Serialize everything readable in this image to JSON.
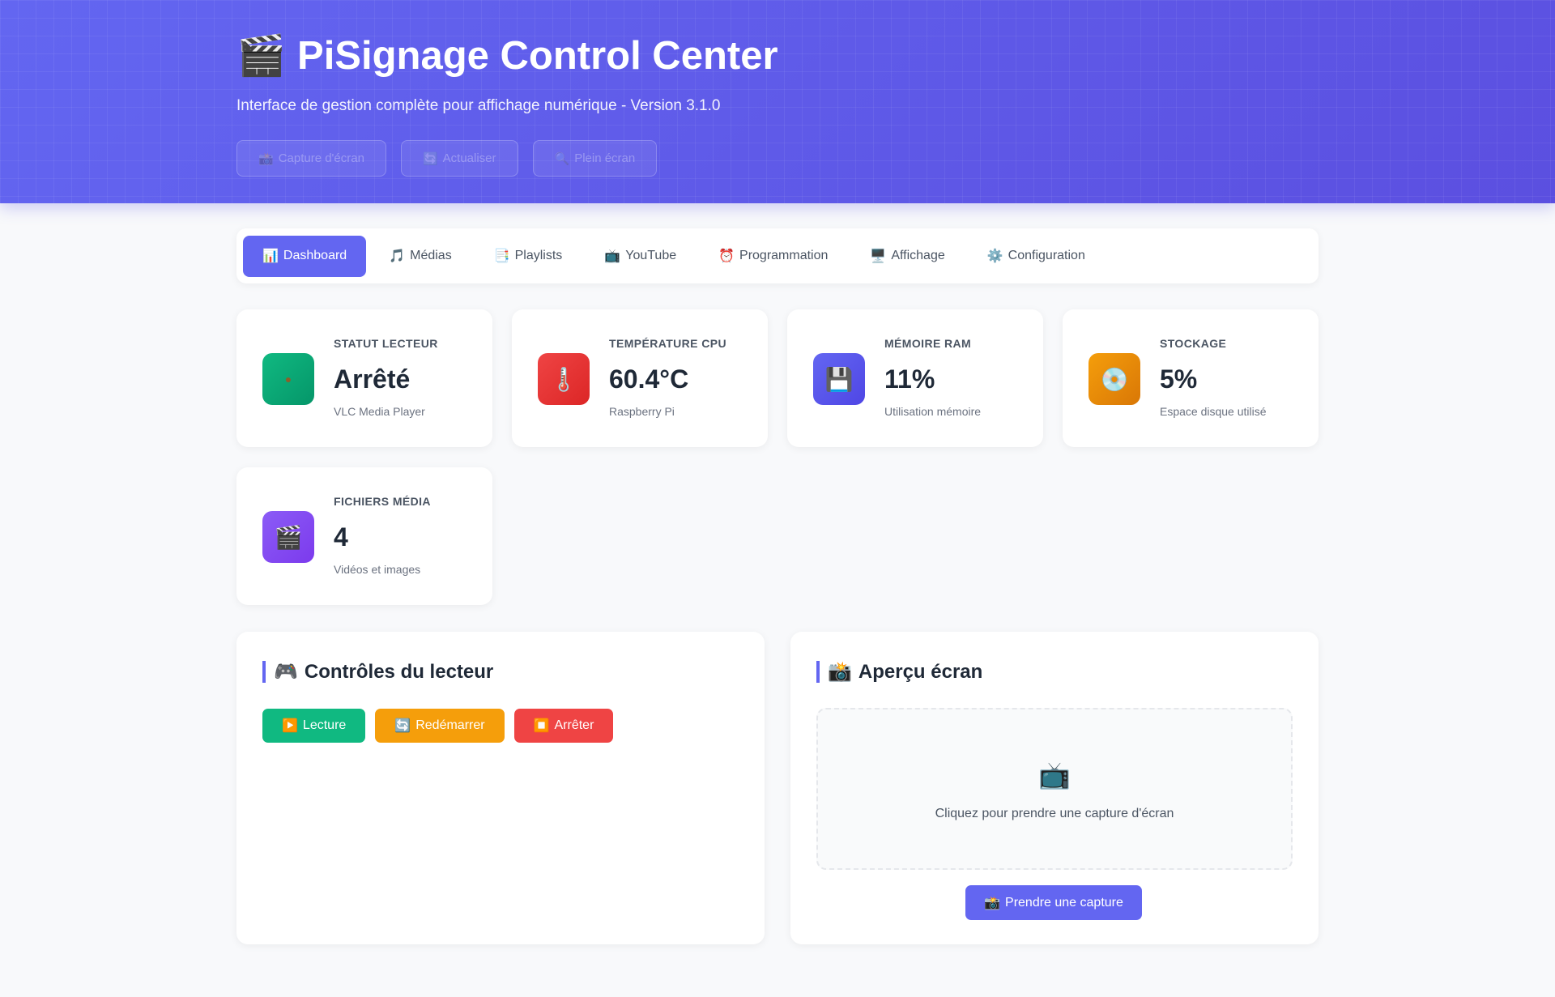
{
  "header": {
    "icon": "🎬",
    "title": "PiSignage Control Center",
    "subtitle": "Interface de gestion complète pour affichage numérique - Version 3.1.0",
    "actions": [
      {
        "icon": "📸",
        "label": "Capture d'écran"
      },
      {
        "icon": "🔄",
        "label": "Actualiser"
      },
      {
        "icon": "🔍",
        "label": "Plein écran"
      }
    ]
  },
  "tabs": [
    {
      "icon": "📊",
      "label": "Dashboard",
      "active": true
    },
    {
      "icon": "🎵",
      "label": "Médias"
    },
    {
      "icon": "📑",
      "label": "Playlists"
    },
    {
      "icon": "📺",
      "label": "YouTube"
    },
    {
      "icon": "⏰",
      "label": "Programmation"
    },
    {
      "icon": "🖥️",
      "label": "Affichage"
    },
    {
      "icon": "⚙️",
      "label": "Configuration"
    }
  ],
  "stats": [
    {
      "icon": "●",
      "icon_name": "status-dot-icon",
      "label": "STATUT LECTEUR",
      "value": "Arrêté",
      "sub": "VLC Media Player",
      "color": "#10b981"
    },
    {
      "icon": "🌡️",
      "icon_name": "thermometer-icon",
      "label": "TEMPÉRATURE CPU",
      "value": "60.4°C",
      "sub": "Raspberry Pi",
      "color": "#ef4444"
    },
    {
      "icon": "💾",
      "icon_name": "floppy-disk-icon",
      "label": "MÉMOIRE RAM",
      "value": "11%",
      "sub": "Utilisation mémoire",
      "color": "#6366f1"
    },
    {
      "icon": "💿",
      "icon_name": "disc-icon",
      "label": "STOCKAGE",
      "value": "5%",
      "sub": "Espace disque utilisé",
      "color": "#f59e0b"
    },
    {
      "icon": "🎬",
      "icon_name": "clapper-icon",
      "label": "FICHIERS MÉDIA",
      "value": "4",
      "sub": "Vidéos et images",
      "color": "#8b5cf6"
    }
  ],
  "controls": {
    "icon": "🎮",
    "title": "Contrôles du lecteur",
    "buttons": [
      {
        "icon": "▶️",
        "label": "Lecture"
      },
      {
        "icon": "🔄",
        "label": "Redémarrer"
      },
      {
        "icon": "⏹️",
        "label": "Arrêter"
      }
    ]
  },
  "preview": {
    "icon": "📸",
    "title": "Aperçu écran",
    "placeholder_icon": "📺",
    "placeholder_text": "Cliquez pour prendre une capture d'écran",
    "capture_icon": "📸",
    "capture_label": "Prendre une capture"
  }
}
